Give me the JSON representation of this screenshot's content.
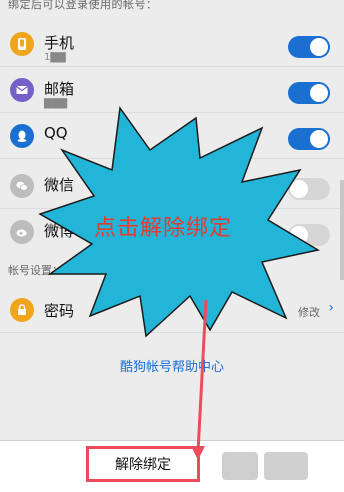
{
  "header": {
    "hint": "绑定后可以登录使用的帐号："
  },
  "accounts": [
    {
      "label": "手机",
      "sub": "1▇▇",
      "icon": "phone-icon",
      "color": "#f0a51d",
      "on": true
    },
    {
      "label": "邮箱",
      "sub": "▇▇▇",
      "icon": "mail-icon",
      "color": "#7560c7",
      "on": true
    },
    {
      "label": "QQ",
      "sub": "",
      "icon": "qq-icon",
      "color": "#1a6fd1",
      "on": true
    },
    {
      "label": "微信",
      "sub": "",
      "icon": "wechat-icon",
      "color": "#bdbdbd",
      "on": false
    },
    {
      "label": "微博",
      "sub": "",
      "icon": "weibo-icon",
      "color": "#bdbdbd",
      "on": false
    }
  ],
  "settings": {
    "section_title": "帐号设置：",
    "password_label": "密码",
    "edit_label": "修改",
    "edit_chevron": "›"
  },
  "help": {
    "link_text": "酷狗帐号帮助中心"
  },
  "bottom": {
    "unbind_label": "解除绑定"
  },
  "annotation": {
    "callout_text": "点击解除绑定",
    "callout_fill": "#22b5d8",
    "arrow_color": "#ee4b5b"
  }
}
